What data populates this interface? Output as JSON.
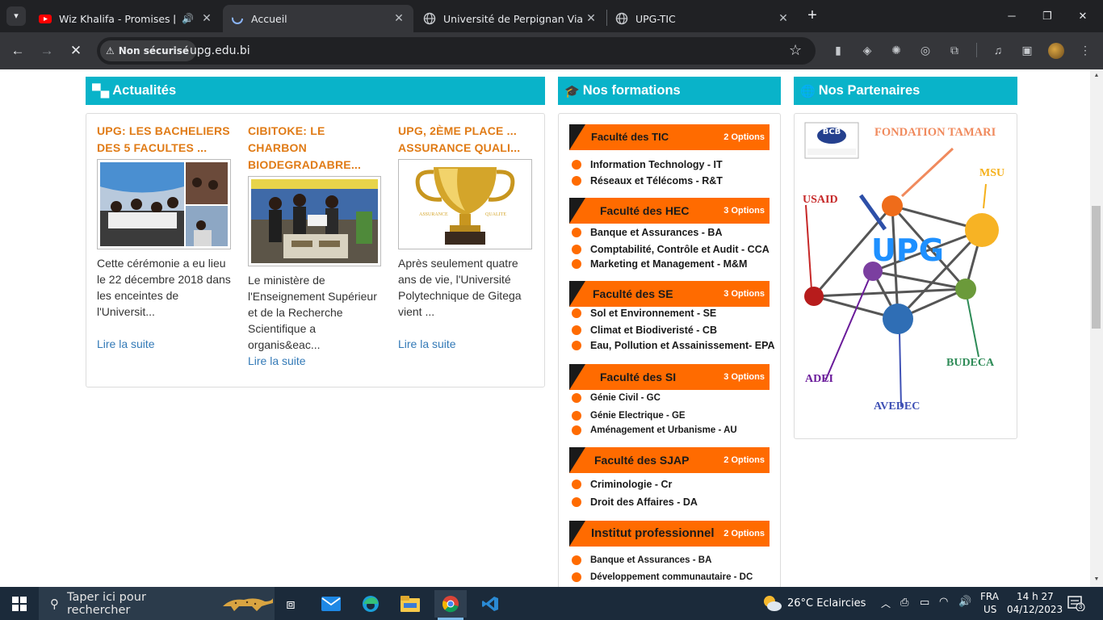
{
  "browser": {
    "tabs": [
      {
        "title": "Wiz Khalifa - Promises [Official",
        "active": false
      },
      {
        "title": "Accueil",
        "active": true
      },
      {
        "title": "Université de Perpignan Via Dom",
        "active": false
      },
      {
        "title": "UPG-TIC",
        "active": false
      }
    ],
    "security_label": "Non sécurisé",
    "url": "upg.edu.bi"
  },
  "sections": {
    "news_heading": "Actualités",
    "formations_heading": "Nos formations",
    "partners_heading": "Nos Partenaires"
  },
  "news": [
    {
      "title_l1": "UPG: LES BACHELIERS",
      "title_l2": "DES 5 FACULTES ...",
      "text": "Cette cérémonie a eu lieu le 22 décembre 2018 dans les enceintes de l'Universit...",
      "read_more": "Lire la suite"
    },
    {
      "title_l1": "CIBITOKE: LE",
      "title_l2": "CHARBON",
      "title_l3": "BIODEGRADABRE...",
      "text": "Le ministère de l'Enseignement Supérieur et de la Recherche Scientifique a organis&eac...",
      "read_more": "Lire la suite"
    },
    {
      "title_l1": "UPG, 2ÈME PLACE ...",
      "title_l2": "ASSURANCE QUALI...",
      "text": "Après seulement quatre ans de vie, l'Université Polytechnique de Gitega vient ...",
      "read_more": "Lire la suite"
    }
  ],
  "trophy_words": [
    "ASSURANCE",
    "QUALITE"
  ],
  "faculties": [
    {
      "name": "Faculté des TIC",
      "options": "2 Options",
      "items": [
        "Information Technology - IT",
        "Réseaux et Télécoms - R&T"
      ]
    },
    {
      "name": "Faculté des HEC",
      "options": "3 Options",
      "items": [
        "Banque et Assurances - BA",
        "Comptabilité, Contrôle et Audit - CCA",
        "Marketing et Management - M&M"
      ]
    },
    {
      "name": "Faculté des SE",
      "options": "3 Options",
      "items": [
        "Sol et Environnement - SE",
        "Climat et Biodiveristé - CB",
        "Eau, Pollution et Assainissement- EPA"
      ]
    },
    {
      "name": "Faculté des SI",
      "options": "3 Options",
      "items": [
        "Génie Civil - GC",
        "Génie Electrique - GE",
        "Aménagement et Urbanisme - AU"
      ]
    },
    {
      "name": "Faculté des SJAP",
      "options": "2 Options",
      "items": [
        "Criminologie - Cr",
        "Droit des Affaires - DA"
      ]
    },
    {
      "name": "Institut professionnel",
      "options": "2 Options",
      "items": [
        "Banque et Assurances - BA",
        "Développement communautaire - DC"
      ]
    }
  ],
  "partners": {
    "center": "UPG",
    "bcb": "BCB",
    "labels": [
      "FONDATION TAMARI",
      "MSU",
      "USAID",
      "BUDECA",
      "ADEI",
      "AVEDEC"
    ]
  },
  "taskbar": {
    "search_placeholder": "Taper ici pour rechercher",
    "weather": "26°C  Eclaircies",
    "lang_top": "FRA",
    "lang_bottom": "US",
    "time": "14 h 27",
    "date": "04/12/2023",
    "notifications": "3"
  }
}
